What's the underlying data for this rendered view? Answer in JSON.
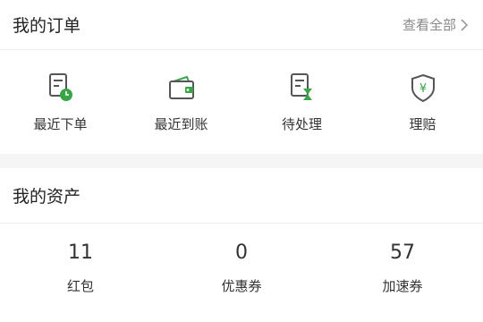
{
  "orders": {
    "title": "我的订单",
    "view_all": "查看全部",
    "items": [
      {
        "label": "最近下单",
        "icon": "doc-clock-icon"
      },
      {
        "label": "最近到账",
        "icon": "wallet-icon"
      },
      {
        "label": "待处理",
        "icon": "doc-hourglass-icon"
      },
      {
        "label": "理赔",
        "icon": "shield-yen-icon"
      }
    ]
  },
  "assets": {
    "title": "我的资产",
    "items": [
      {
        "value": "11",
        "label": "红包"
      },
      {
        "value": "0",
        "label": "优惠券"
      },
      {
        "value": "57",
        "label": "加速券"
      }
    ]
  },
  "colors": {
    "accent": "#3aa548",
    "icon_outline": "#555555",
    "muted": "#8a8a8a"
  }
}
